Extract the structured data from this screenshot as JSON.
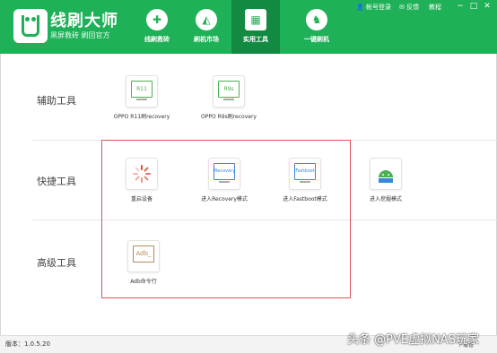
{
  "header": {
    "title": "线刷大师",
    "subtitle": "黑屏救砖  刷回官方",
    "tabs": [
      {
        "label": "线刷救砖",
        "icon": "plus-icon"
      },
      {
        "label": "刷机市场",
        "icon": "android-icon"
      },
      {
        "label": "实用工具",
        "icon": "grid-icon",
        "active": true
      },
      {
        "label": "一键刷机",
        "icon": "bunny-icon"
      }
    ],
    "top_links": {
      "login": "帐号登录",
      "feedback": "反馈",
      "tutorial": "教程"
    }
  },
  "sections": [
    {
      "label": "辅助工具",
      "tools": [
        {
          "label": "OPPO R11刷recovery",
          "icon_text": "R11"
        },
        {
          "label": "OPPO R9s刷recovery",
          "icon_text": "R9s"
        }
      ]
    },
    {
      "label": "快捷工具",
      "tools": [
        {
          "label": "重启设备",
          "icon_text": ""
        },
        {
          "label": "进入Recovery模式",
          "icon_text": "Recovery"
        },
        {
          "label": "进入Fastboot模式",
          "icon_text": "Fastboot"
        },
        {
          "label": "进入挖掘模式",
          "icon_text": ""
        }
      ]
    },
    {
      "label": "高级工具",
      "tools": [
        {
          "label": "Adb命令行",
          "icon_text": "Adb_"
        }
      ]
    }
  ],
  "footer": {
    "version": "版本：1.0.5.20",
    "right_text": "下载管"
  },
  "watermark": "头条 @PVE虚拟NAS玩家",
  "colors": {
    "brand": "#1fb157",
    "active_tab": "#128a42",
    "highlight": "#e0505a"
  }
}
